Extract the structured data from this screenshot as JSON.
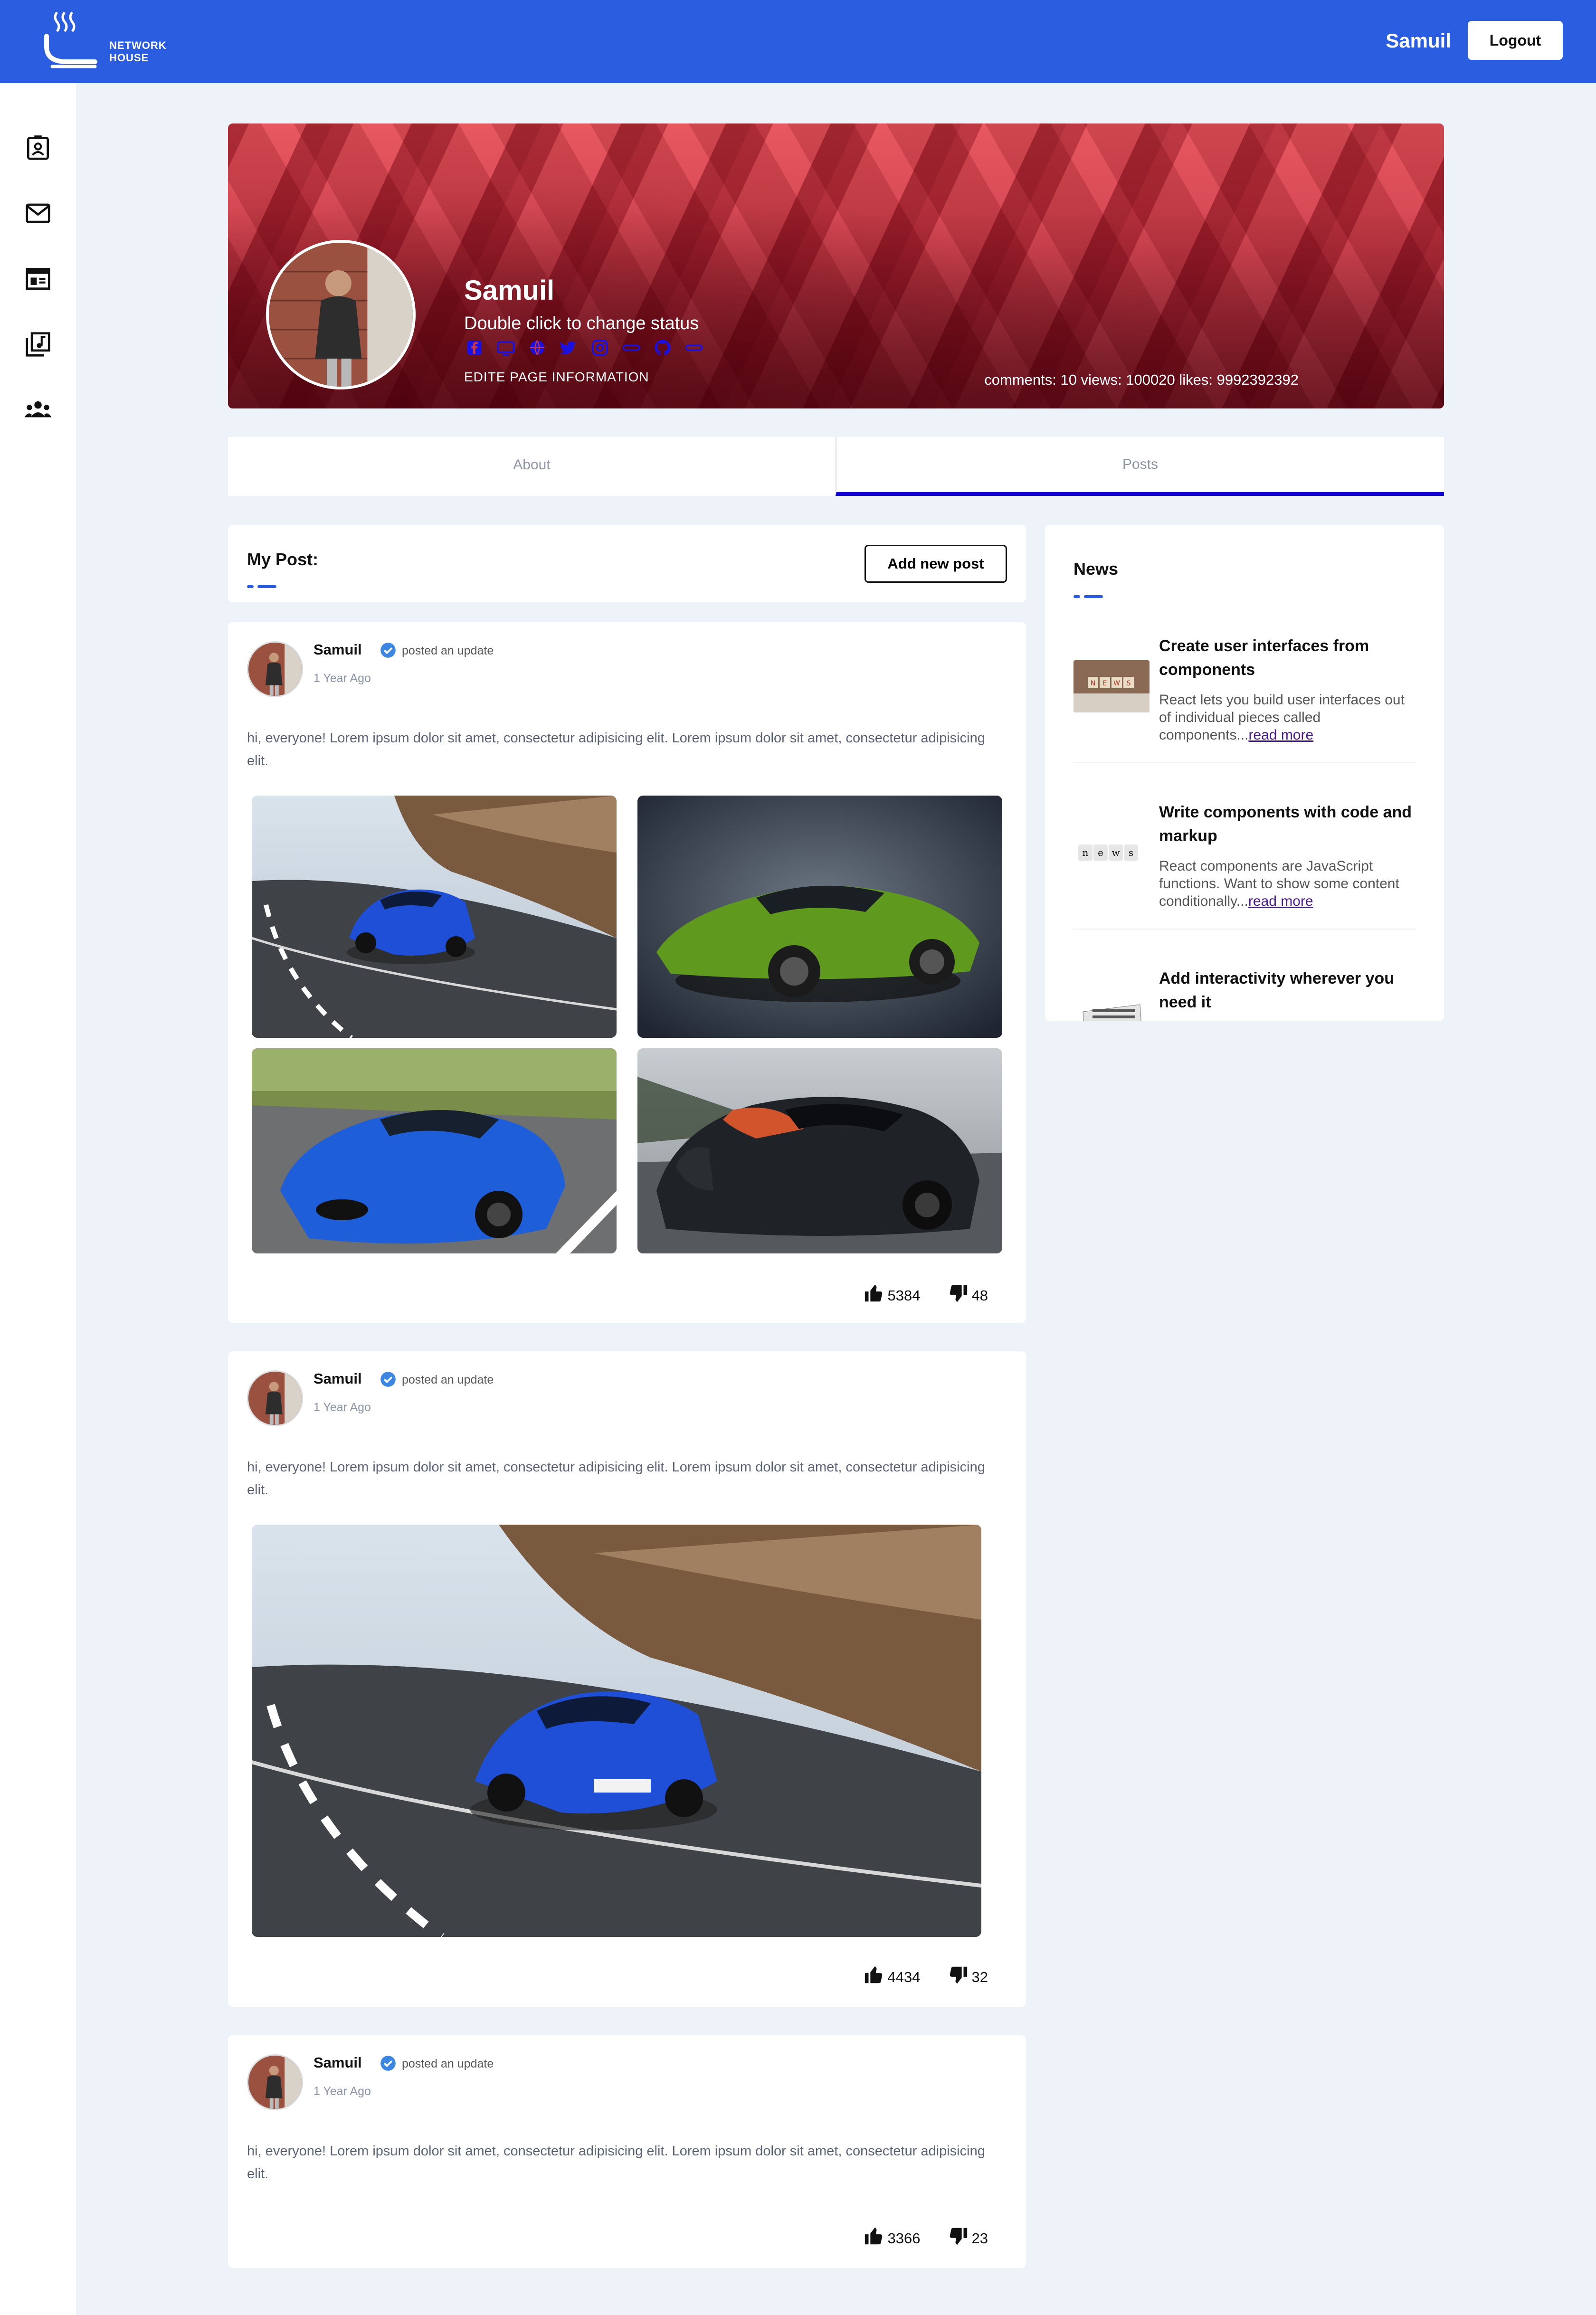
{
  "header": {
    "logo_text": "NETWORK HOUSE",
    "username": "Samuil",
    "logout_label": "Logout",
    "brand_color": "#2b5de0"
  },
  "sidebar": {
    "items": [
      {
        "icon": "contact-card-icon"
      },
      {
        "icon": "mail-icon"
      },
      {
        "icon": "newspaper-icon"
      },
      {
        "icon": "music-library-icon"
      },
      {
        "icon": "groups-icon"
      }
    ]
  },
  "profile": {
    "name": "Samuil",
    "status": "Double click to change status",
    "edit_label": "EDITE PAGE INFORMATION",
    "stats": "comments: 10 views: 100020 likes: 9992392392",
    "socials": [
      "facebook-icon",
      "tv-icon",
      "globe-icon",
      "twitter-icon",
      "instagram-icon",
      "link-icon",
      "github-icon",
      "link-icon"
    ]
  },
  "tabs": [
    {
      "label": "About",
      "active": false
    },
    {
      "label": "Posts",
      "active": true
    }
  ],
  "my_post": {
    "title": "My Post:",
    "add_label": "Add new post"
  },
  "posts": [
    {
      "author": "Samuil",
      "action": "posted an update",
      "time": "1 Year Ago",
      "text": "hi, everyone! Lorem ipsum dolor sit amet, consectetur adipisicing elit. Lorem ipsum dolor sit amet, consectetur adipisicing elit.",
      "likes": "5384",
      "dislikes": "48",
      "images": [
        "blue-mclaren-road",
        "green-mclaren-studio",
        "blue-maserati-road",
        "black-bugatti-track"
      ]
    },
    {
      "author": "Samuil",
      "action": "posted an update",
      "time": "1 Year Ago",
      "text": "hi, everyone! Lorem ipsum dolor sit amet, consectetur adipisicing elit. Lorem ipsum dolor sit amet, consectetur adipisicing elit.",
      "likes": "4434",
      "dislikes": "32",
      "images": [
        "blue-mclaren-road"
      ]
    },
    {
      "author": "Samuil",
      "action": "posted an update",
      "time": "1 Year Ago",
      "text": "hi, everyone! Lorem ipsum dolor sit amet, consectetur adipisicing elit. Lorem ipsum dolor sit amet, consectetur adipisicing elit.",
      "likes": "3366",
      "dislikes": "23",
      "images": []
    }
  ],
  "news": {
    "title": "News",
    "items": [
      {
        "heading": "Create user interfaces from components",
        "body": "React lets you build user interfaces out of individual pieces called components...",
        "link": "read more"
      },
      {
        "heading": "Write components with code and markup",
        "body": "React components are JavaScript functions. Want to show some content conditionally...",
        "link": "read more"
      },
      {
        "heading": "Add interactivity wherever you need it",
        "body": "",
        "link": ""
      }
    ]
  }
}
